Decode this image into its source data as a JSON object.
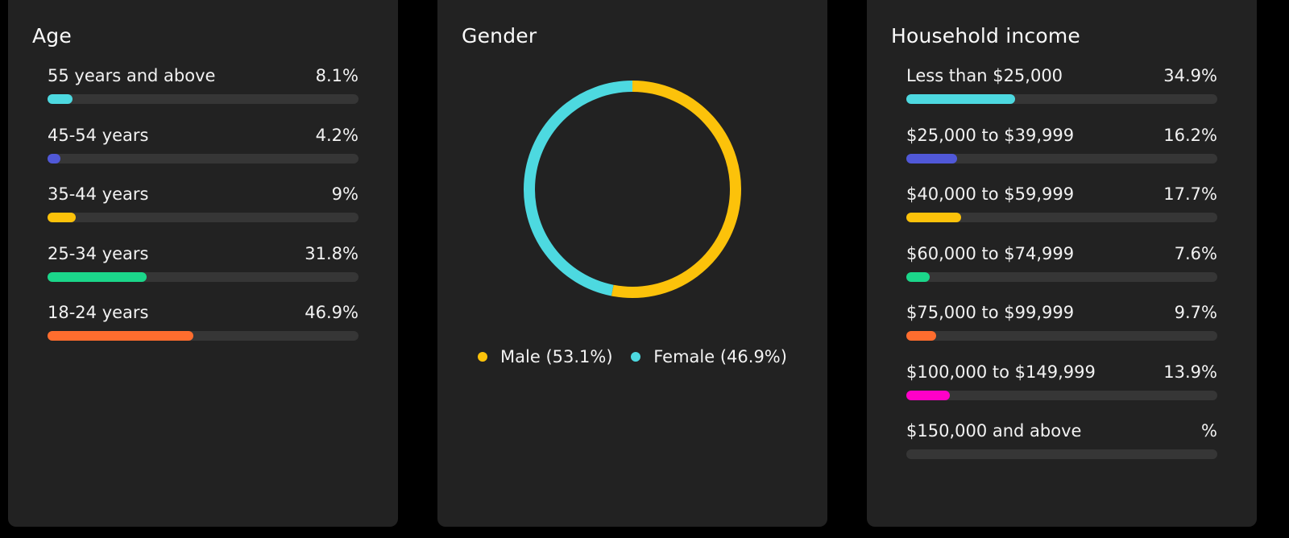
{
  "age": {
    "title": "Age",
    "items": [
      {
        "label": "55 years and above",
        "value_text": "8.1%",
        "value": 8.1,
        "color": "#4dd9e0"
      },
      {
        "label": "45-54 years",
        "value_text": "4.2%",
        "value": 4.2,
        "color": "#5058d8"
      },
      {
        "label": "35-44 years",
        "value_text": "9%",
        "value": 9,
        "color": "#fcc20a"
      },
      {
        "label": "25-34 years",
        "value_text": "31.8%",
        "value": 31.8,
        "color": "#1bd68a"
      },
      {
        "label": "18-24 years",
        "value_text": "46.9%",
        "value": 46.9,
        "color": "#ff6d2e"
      }
    ]
  },
  "gender": {
    "title": "Gender",
    "legend": [
      {
        "label": "Male (53.1%)",
        "color": "#fcc20a"
      },
      {
        "label": "Female (46.9%)",
        "color": "#4dd9e0"
      }
    ]
  },
  "income": {
    "title": "Household income",
    "items": [
      {
        "label": "Less than $25,000",
        "value_text": "34.9%",
        "value": 34.9,
        "color": "#4dd9e0"
      },
      {
        "label": "$25,000 to $39,999",
        "value_text": "16.2%",
        "value": 16.2,
        "color": "#5058d8"
      },
      {
        "label": "$40,000 to $59,999",
        "value_text": "17.7%",
        "value": 17.7,
        "color": "#fcc20a"
      },
      {
        "label": "$60,000 to $74,999",
        "value_text": "7.6%",
        "value": 7.6,
        "color": "#1bd68a"
      },
      {
        "label": "$75,000 to $99,999",
        "value_text": "9.7%",
        "value": 9.7,
        "color": "#ff6d2e"
      },
      {
        "label": "$100,000 to $149,999",
        "value_text": "13.9%",
        "value": 13.9,
        "color": "#ff00c8"
      },
      {
        "label": "$150,000 and above",
        "value_text": "%",
        "value": 0,
        "color": "#ff00c8"
      }
    ]
  },
  "chart_data": [
    {
      "type": "bar",
      "title": "Age",
      "orientation": "horizontal",
      "categories": [
        "55 years and above",
        "45-54 years",
        "35-44 years",
        "25-34 years",
        "18-24 years"
      ],
      "values": [
        8.1,
        4.2,
        9,
        31.8,
        46.9
      ],
      "unit": "%",
      "xlim": [
        0,
        100
      ]
    },
    {
      "type": "pie",
      "title": "Gender",
      "style": "donut",
      "categories": [
        "Male",
        "Female"
      ],
      "values": [
        53.1,
        46.9
      ],
      "colors": [
        "#fcc20a",
        "#4dd9e0"
      ],
      "legend": "bottom"
    },
    {
      "type": "bar",
      "title": "Household income",
      "orientation": "horizontal",
      "categories": [
        "Less than $25,000",
        "$25,000 to $39,999",
        "$40,000 to $59,999",
        "$60,000 to $74,999",
        "$75,000 to $99,999",
        "$100,000 to $149,999",
        "$150,000 and above"
      ],
      "values": [
        34.9,
        16.2,
        17.7,
        7.6,
        9.7,
        13.9,
        null
      ],
      "unit": "%",
      "xlim": [
        0,
        100
      ]
    }
  ]
}
